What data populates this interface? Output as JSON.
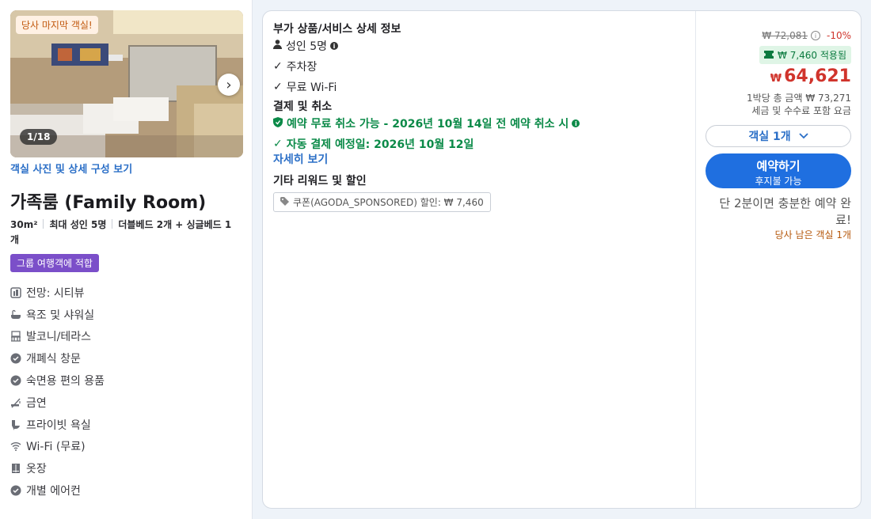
{
  "room_card": {
    "badge_last_room": "당사 마지막 객실!",
    "photo_counter": "1/18",
    "photo_link": "객실 사진 및 상세 구성 보기",
    "title": "가족룸 (Family Room)",
    "specs": {
      "size": "30m²",
      "occupancy": "최대 성인 5명",
      "beds": "더블베드 2개 + 싱글베드 1개"
    },
    "group_badge": "그룹 여행객에 적합",
    "amenities": [
      {
        "icon": "city-view-icon",
        "label": "전망: 시티뷰"
      },
      {
        "icon": "bathtub-icon",
        "label": "욕조 및 샤워실"
      },
      {
        "icon": "balcony-icon",
        "label": "발코니/테라스"
      },
      {
        "icon": "check-circle-icon",
        "label": "개폐식 창문"
      },
      {
        "icon": "check-circle-icon",
        "label": "숙면용 편의 용품"
      },
      {
        "icon": "no-smoking-icon",
        "label": "금연"
      },
      {
        "icon": "toilet-icon",
        "label": "프라이빗 욕실"
      },
      {
        "icon": "wifi-icon",
        "label": "Wi-Fi (무료)"
      },
      {
        "icon": "wardrobe-icon",
        "label": "옷장"
      },
      {
        "icon": "air-conditioner-icon",
        "label": "개별 에어컨"
      }
    ]
  },
  "details": {
    "extras_title": "부가 상품/서비스 상세 정보",
    "adults": "성인 5명",
    "parking": "주차장",
    "wifi": "무료 Wi-Fi",
    "payment_title": "결제 및 취소",
    "free_cancel": "예약 무료 취소 가능 - 2026년 10월 14일 전 예약 취소 시",
    "auto_pay": "자동 결제 예정일: 2026년 10월 12일",
    "more_link": "자세히 보기",
    "rewards_title": "기타 리워드 및 할인",
    "coupon": "쿠폰(AGODA_SPONSORED) 할인: ₩ 7,460"
  },
  "pricing": {
    "original_price": "₩ 72,081",
    "discount": "-10%",
    "applied": "₩ 7,460 적용됨",
    "currency": "₩",
    "price": "64,621",
    "per_night": "1박당 총 금액 ₩ 73,271",
    "tax_note": "세금 및 수수료 포함 요금",
    "room_select": "객실 1개",
    "book_label": "예약하기",
    "book_sub": "후지불 가능",
    "urgency": "단 2분이면 충분한 예약 완료!",
    "rooms_left": "당사 남은 객실 1개"
  },
  "colors": {
    "accent": "#1f6fe0",
    "price_red": "#d0342c",
    "success_green": "#0b8a48",
    "badge_purple": "#7b4fc9"
  }
}
